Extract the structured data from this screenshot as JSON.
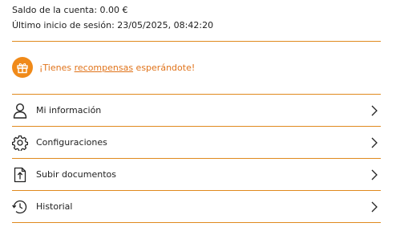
{
  "account": {
    "balance_text": "Saldo de la cuenta: 0.00 €",
    "last_login_text": "Último inicio de sesión: 23/05/2025, 08:42:20"
  },
  "rewards": {
    "prefix": "¡Tienes ",
    "link": "recompensas",
    "suffix": " esperándote!",
    "icon": "gift-icon"
  },
  "menu": [
    {
      "label": "Mi información",
      "icon": "user-icon"
    },
    {
      "label": "Configuraciones",
      "icon": "gear-icon"
    },
    {
      "label": "Subir documentos",
      "icon": "upload-document-icon"
    },
    {
      "label": "Historial",
      "icon": "history-icon"
    }
  ],
  "colors": {
    "accent": "#e08a1e",
    "gift_bg": "#f08a19",
    "rewards_text": "#e0731a"
  }
}
